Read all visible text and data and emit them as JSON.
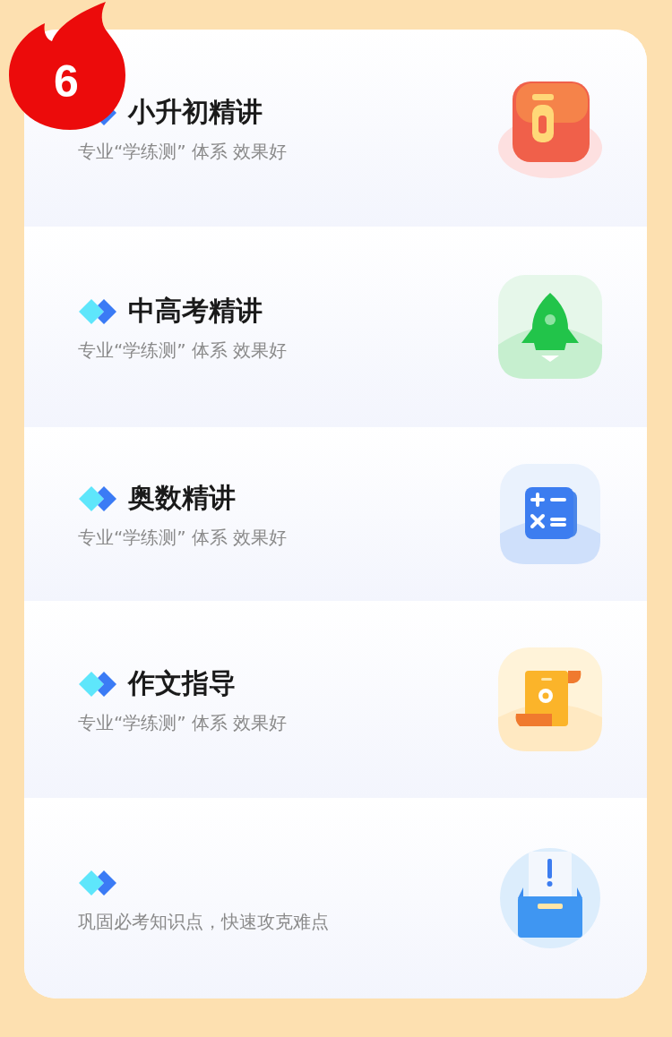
{
  "badge": {
    "text": "6"
  },
  "courses": [
    {
      "title": "小升初精讲",
      "subtitle": "专业“学练测” 体系 效果好",
      "kind": "letter"
    },
    {
      "title": "中高考精讲",
      "subtitle": "专业“学练测” 体系 效果好",
      "kind": "rocket"
    },
    {
      "title": "奥数精讲",
      "subtitle": "专业“学练测” 体系 效果好",
      "kind": "calc"
    },
    {
      "title": "作文指导",
      "subtitle": "专业“学练测” 体系 效果好",
      "kind": "scroll"
    },
    {
      "subtitle": "巩固必考知识点，快速攻克难点",
      "kind": "box"
    }
  ]
}
